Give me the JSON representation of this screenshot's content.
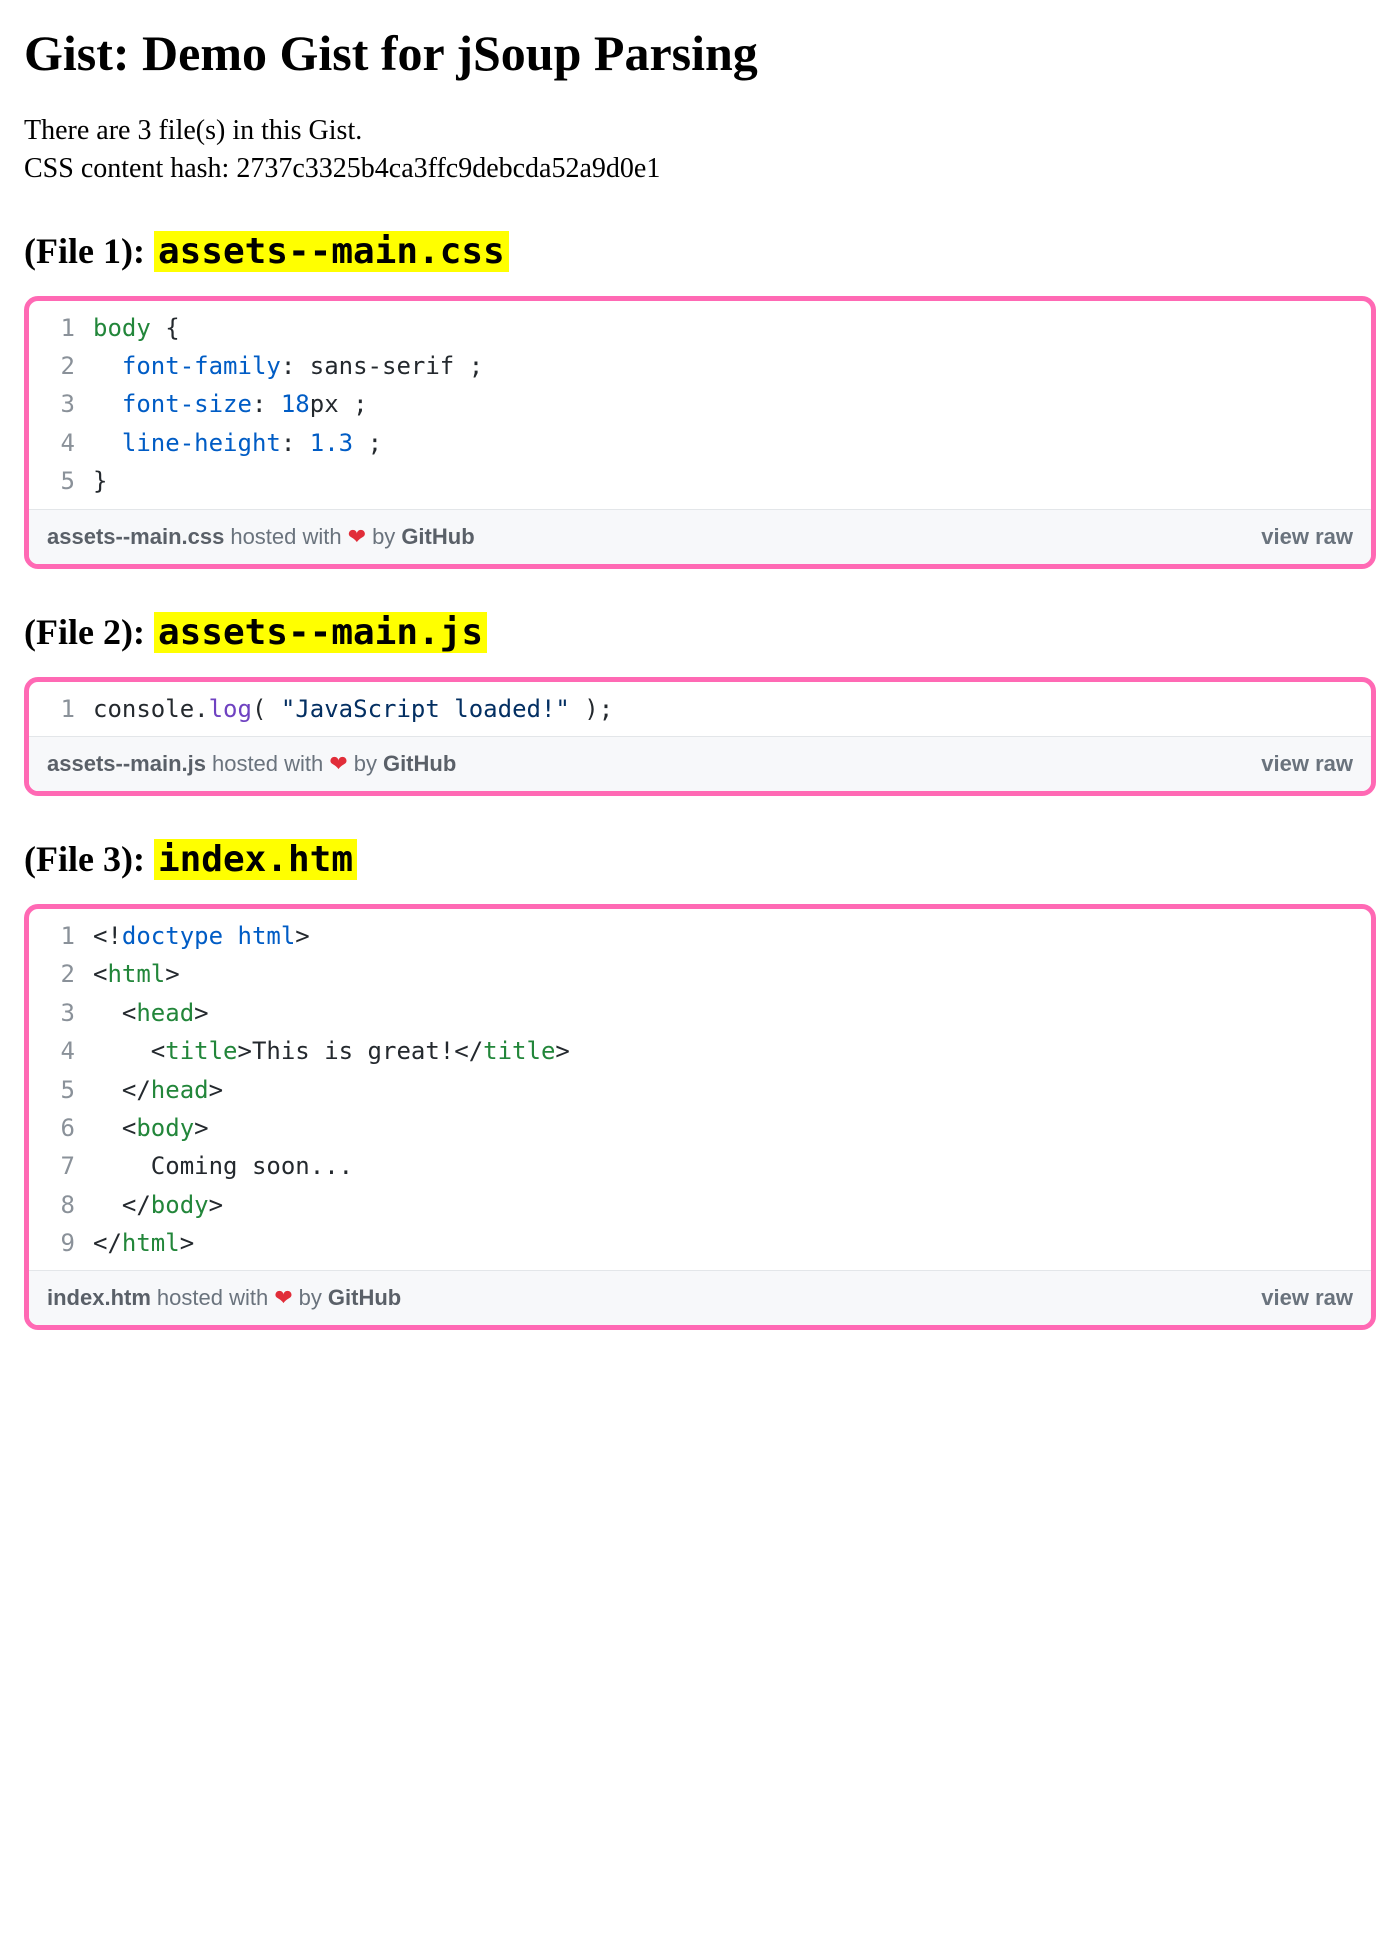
{
  "title": "Gist: Demo Gist for jSoup Parsing",
  "info_line1": "There are 3 file(s) in this Gist.",
  "info_line2": "CSS content hash: 2737c3325b4ca3ffc9debcda52a9d0e1",
  "hosted_with": "hosted with",
  "by": "by",
  "github": "GitHub",
  "view_raw": "view raw",
  "files": [
    {
      "heading_prefix": "(File 1): ",
      "filename": "assets--main.css",
      "footer_filename": "assets--main.css",
      "lines": [
        {
          "n": "1",
          "segs": [
            {
              "t": "body",
              "cls": "c-sel"
            },
            {
              "t": " {",
              "cls": "c-plain"
            }
          ]
        },
        {
          "n": "2",
          "segs": [
            {
              "t": "  ",
              "cls": "c-plain"
            },
            {
              "t": "font-family",
              "cls": "c-prop"
            },
            {
              "t": ": sans-serif ;",
              "cls": "c-plain"
            }
          ]
        },
        {
          "n": "3",
          "segs": [
            {
              "t": "  ",
              "cls": "c-plain"
            },
            {
              "t": "font-size",
              "cls": "c-prop"
            },
            {
              "t": ": ",
              "cls": "c-plain"
            },
            {
              "t": "18",
              "cls": "c-num"
            },
            {
              "t": "px",
              "cls": "c-plain"
            },
            {
              "t": " ;",
              "cls": "c-plain"
            }
          ]
        },
        {
          "n": "4",
          "segs": [
            {
              "t": "  ",
              "cls": "c-plain"
            },
            {
              "t": "line-height",
              "cls": "c-prop"
            },
            {
              "t": ": ",
              "cls": "c-plain"
            },
            {
              "t": "1.3",
              "cls": "c-num"
            },
            {
              "t": " ;",
              "cls": "c-plain"
            }
          ]
        },
        {
          "n": "5",
          "segs": [
            {
              "t": "}",
              "cls": "c-plain"
            }
          ]
        }
      ]
    },
    {
      "heading_prefix": "(File 2): ",
      "filename": "assets--main.js",
      "footer_filename": "assets--main.js",
      "lines": [
        {
          "n": "1",
          "segs": [
            {
              "t": "console",
              "cls": "c-plain"
            },
            {
              "t": ".",
              "cls": "c-plain"
            },
            {
              "t": "log",
              "cls": "c-func"
            },
            {
              "t": "( ",
              "cls": "c-plain"
            },
            {
              "t": "\"JavaScript loaded!\"",
              "cls": "c-str"
            },
            {
              "t": " );",
              "cls": "c-plain"
            }
          ]
        }
      ]
    },
    {
      "heading_prefix": "(File 3): ",
      "filename": "index.htm",
      "footer_filename": "index.htm",
      "lines": [
        {
          "n": "1",
          "segs": [
            {
              "t": "<!",
              "cls": "c-plain"
            },
            {
              "t": "doctype ",
              "cls": "c-prop"
            },
            {
              "t": "html",
              "cls": "c-prop"
            },
            {
              "t": ">",
              "cls": "c-plain"
            }
          ]
        },
        {
          "n": "2",
          "segs": [
            {
              "t": "<",
              "cls": "c-plain"
            },
            {
              "t": "html",
              "cls": "c-sel"
            },
            {
              "t": ">",
              "cls": "c-plain"
            }
          ]
        },
        {
          "n": "3",
          "segs": [
            {
              "t": "  <",
              "cls": "c-plain"
            },
            {
              "t": "head",
              "cls": "c-sel"
            },
            {
              "t": ">",
              "cls": "c-plain"
            }
          ]
        },
        {
          "n": "4",
          "segs": [
            {
              "t": "    <",
              "cls": "c-plain"
            },
            {
              "t": "title",
              "cls": "c-sel"
            },
            {
              "t": ">",
              "cls": "c-plain"
            },
            {
              "t": "This is great!",
              "cls": "c-plain"
            },
            {
              "t": "</",
              "cls": "c-plain"
            },
            {
              "t": "title",
              "cls": "c-sel"
            },
            {
              "t": ">",
              "cls": "c-plain"
            }
          ]
        },
        {
          "n": "5",
          "segs": [
            {
              "t": "  </",
              "cls": "c-plain"
            },
            {
              "t": "head",
              "cls": "c-sel"
            },
            {
              "t": ">",
              "cls": "c-plain"
            }
          ]
        },
        {
          "n": "6",
          "segs": [
            {
              "t": "  <",
              "cls": "c-plain"
            },
            {
              "t": "body",
              "cls": "c-sel"
            },
            {
              "t": ">",
              "cls": "c-plain"
            }
          ]
        },
        {
          "n": "7",
          "segs": [
            {
              "t": "    Coming soon...",
              "cls": "c-plain"
            }
          ]
        },
        {
          "n": "8",
          "segs": [
            {
              "t": "  </",
              "cls": "c-plain"
            },
            {
              "t": "body",
              "cls": "c-sel"
            },
            {
              "t": ">",
              "cls": "c-plain"
            }
          ]
        },
        {
          "n": "9",
          "segs": [
            {
              "t": "</",
              "cls": "c-plain"
            },
            {
              "t": "html",
              "cls": "c-sel"
            },
            {
              "t": ">",
              "cls": "c-plain"
            }
          ]
        }
      ]
    }
  ]
}
